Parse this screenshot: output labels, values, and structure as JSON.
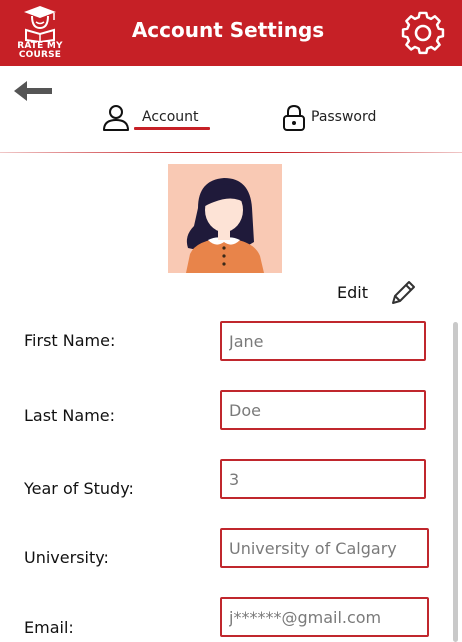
{
  "header": {
    "logo_text_line1": "RATE MY",
    "logo_text_line2": "COURSE",
    "title": "Account Settings",
    "settings_icon": "gear-icon",
    "brand_color": "#c62026"
  },
  "nav": {
    "back_icon": "arrow-left-icon",
    "tabs": [
      {
        "label": "Account",
        "icon": "user-icon",
        "active": true
      },
      {
        "label": "Password",
        "icon": "lock-icon",
        "active": false
      }
    ]
  },
  "profile": {
    "avatar": "avatar-woman",
    "edit_label": "Edit",
    "edit_icon": "pencil-icon"
  },
  "form": {
    "fields": [
      {
        "label": "First Name:",
        "value": "Jane"
      },
      {
        "label": "Last Name:",
        "value": "Doe"
      },
      {
        "label": "Year of Study:",
        "value": "3"
      },
      {
        "label": "University:",
        "value": "University of Calgary"
      },
      {
        "label": "Email:",
        "value": "j******@gmail.com"
      }
    ]
  }
}
